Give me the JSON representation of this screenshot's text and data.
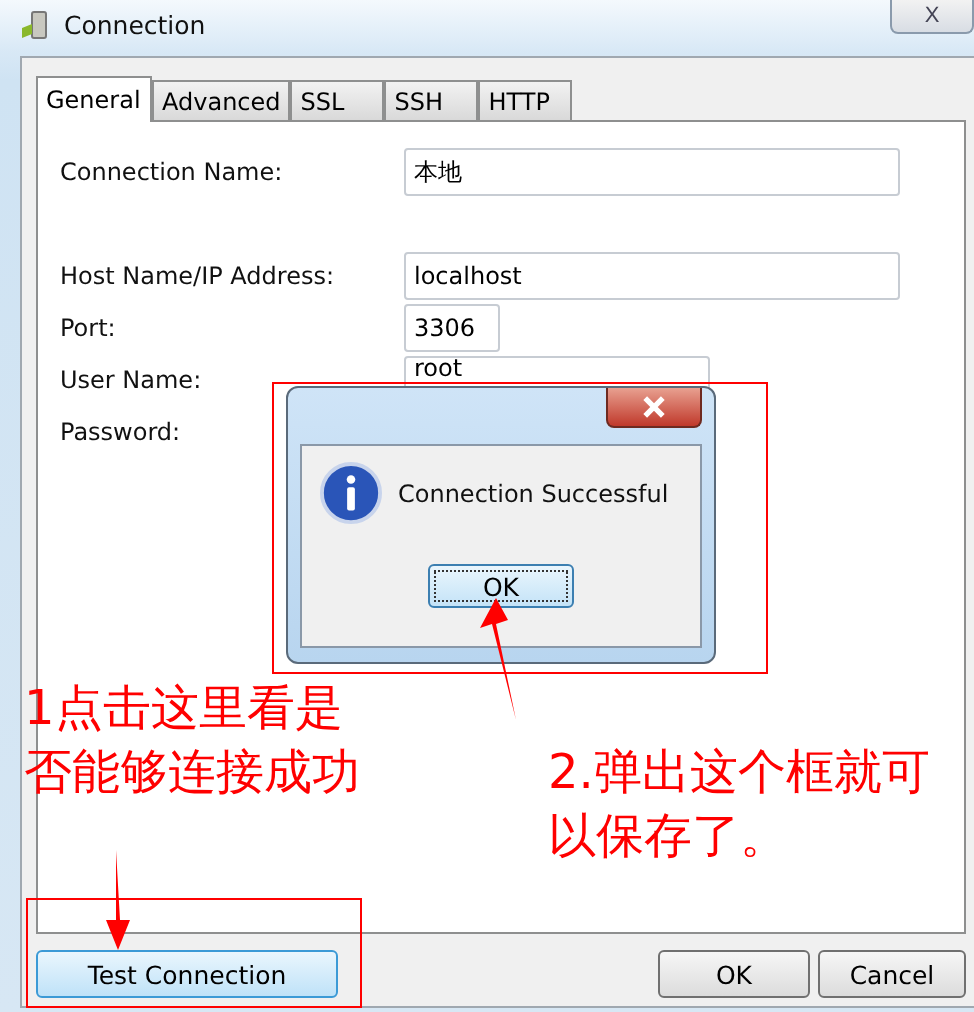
{
  "window": {
    "title": "Connection",
    "close": "X"
  },
  "tabs": [
    {
      "label": "General",
      "selected": true
    },
    {
      "label": "Advanced",
      "selected": false
    },
    {
      "label": "SSL",
      "selected": false
    },
    {
      "label": "SSH",
      "selected": false
    },
    {
      "label": "HTTP",
      "selected": false
    }
  ],
  "fields": [
    {
      "label": "Connection Name:",
      "value": "本地"
    },
    {
      "label": "Host Name/IP Address:",
      "value": "localhost"
    },
    {
      "label": "Port:",
      "value": "3306"
    },
    {
      "label": "User Name:",
      "value": "root"
    },
    {
      "label": "Password:"
    }
  ],
  "dialog": {
    "message": "Connection Successful",
    "button": "OK"
  },
  "buttons": [
    {
      "label": "Test Connection",
      "kind": "test"
    },
    {
      "label": "OK",
      "kind": "ok"
    },
    {
      "label": "Cancel",
      "kind": "cancel"
    }
  ],
  "annotations": [
    "1点击这里看是否能够连接成功",
    "2.弹出这个框就可以保存了。"
  ]
}
